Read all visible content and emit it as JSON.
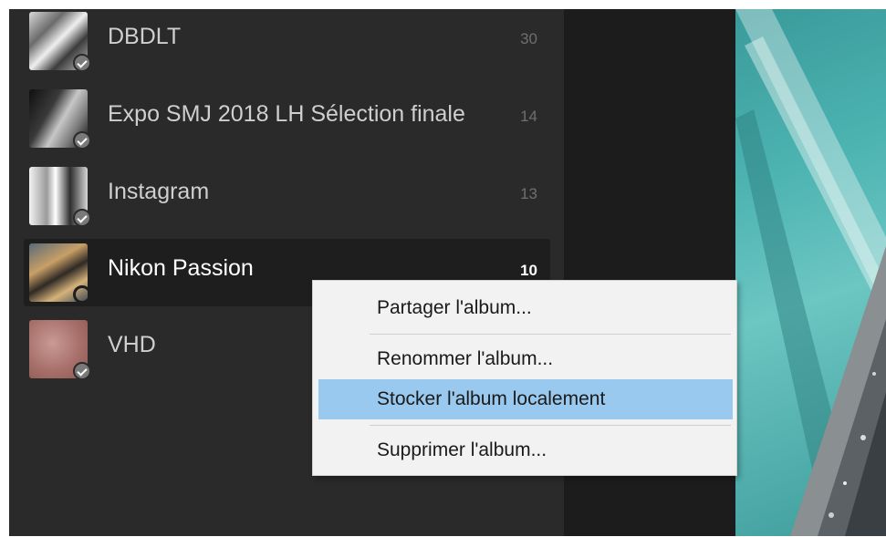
{
  "albums": [
    {
      "name": "DBDLT",
      "count": "30",
      "sync": "check"
    },
    {
      "name": "Expo SMJ 2018 LH Sélection finale",
      "count": "14",
      "sync": "check"
    },
    {
      "name": "Instagram",
      "count": "13",
      "sync": "check"
    },
    {
      "name": "Nikon Passion",
      "count": "10",
      "sync": "syncing",
      "selected": true
    },
    {
      "name": "VHD",
      "count": "",
      "sync": "check"
    }
  ],
  "context_menu": {
    "share_label": "Partager l'album...",
    "rename_label": "Renommer l'album...",
    "store_local_label": "Stocker l'album localement",
    "delete_label": "Supprimer l'album...",
    "highlighted": "store_local"
  },
  "colors": {
    "sidebar_bg": "#2a2a2a",
    "selected_bg": "#1e1e1e",
    "menu_bg": "#f2f2f2",
    "menu_highlight": "#99c9ee",
    "sync_accent": "#1e8ae6"
  },
  "icons": {
    "synced": "check-circle-icon",
    "syncing": "sync-progress-icon"
  }
}
